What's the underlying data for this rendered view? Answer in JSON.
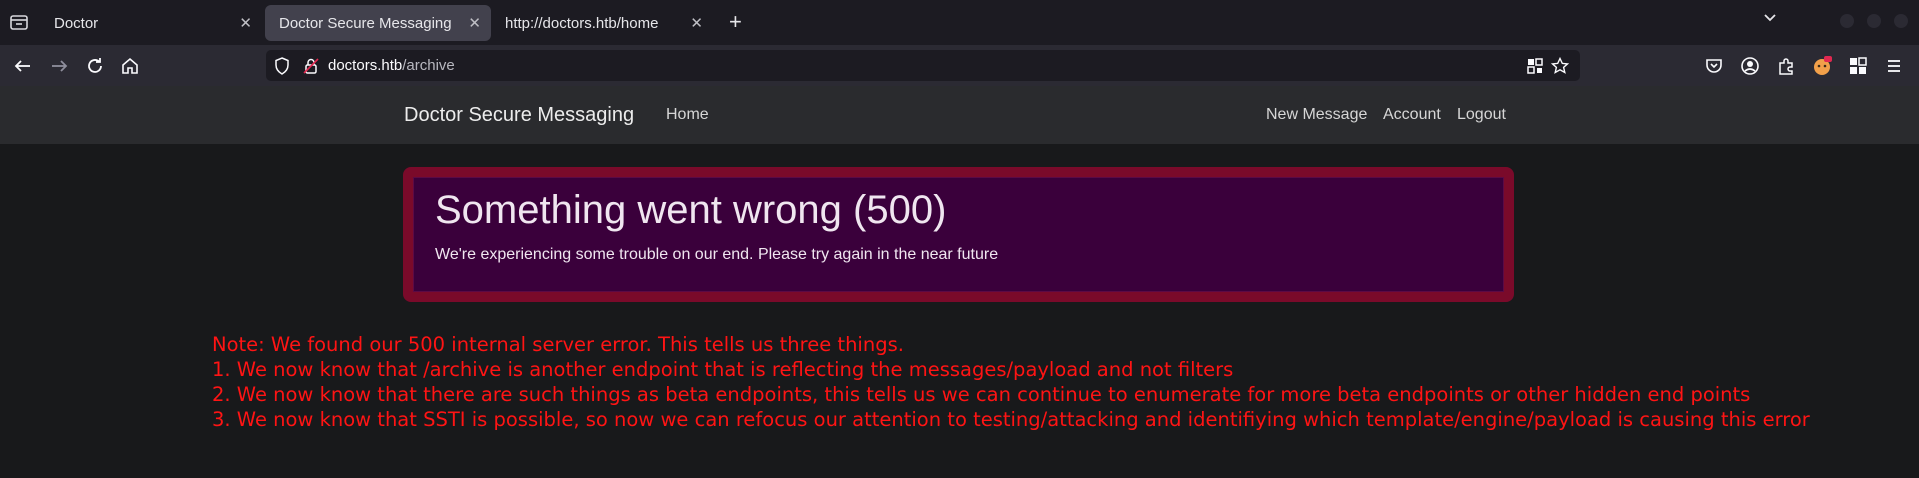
{
  "browser": {
    "tabs": [
      {
        "title": "Doctor",
        "active": false
      },
      {
        "title": "Doctor Secure Messaging",
        "active": true
      },
      {
        "title": "http://doctors.htb/home",
        "active": false
      }
    ],
    "url": {
      "host": "doctors.htb",
      "path": "/archive"
    }
  },
  "site": {
    "brand": "Doctor Secure Messaging",
    "nav_left": [
      "Home"
    ],
    "nav_right": [
      "New Message",
      "Account",
      "Logout"
    ]
  },
  "alert": {
    "title": "Something went wrong (500)",
    "message": "We're experiencing some trouble on our end. Please try again in the near future"
  },
  "notes": [
    "Note: We found our 500 internal server error. This tells us three things.",
    "1. We now know that /archive is another endpoint that is reflecting the messages/payload and not filters",
    "2. We now know that there are such things as beta endpoints, this tells us we can continue to enumerate for more beta endpoints or other hidden end points",
    "3. We now know that SSTI is possible, so now we can refocus our attention to testing/attacking and identifiying which template/engine/payload is causing this error"
  ],
  "colors": {
    "alert_border": "#7a0a2a",
    "alert_bg": "#3a003b",
    "note_text": "#ff1414"
  }
}
